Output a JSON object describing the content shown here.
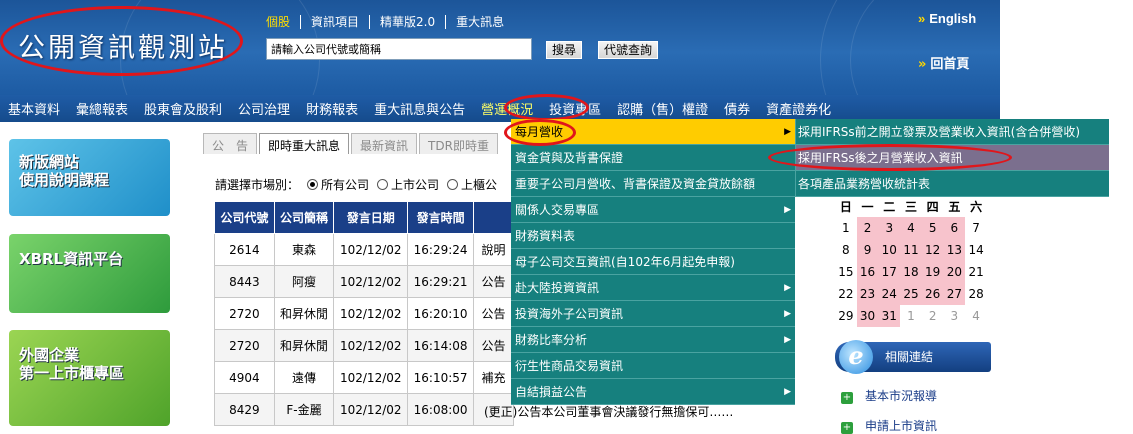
{
  "header": {
    "logo": "公開資訊觀測站",
    "top_links": [
      "個股",
      "資訊項目",
      "精華版2.0",
      "重大訊息"
    ],
    "search_placeholder": "請輸入公司代號或簡稱",
    "search_button": "搜尋",
    "code_button": "代號查詢",
    "english": "English",
    "home": "回首頁"
  },
  "nav": [
    "基本資料",
    "彙總報表",
    "股東會及股利",
    "公司治理",
    "財務報表",
    "重大訊息與公告",
    "營運概況",
    "投資專區",
    "認購（售）權證",
    "債券",
    "資產證券化"
  ],
  "banners": [
    "新版網站\n使用說明課程",
    "XBRL資訊平台",
    "外國企業\n第一上市櫃專區"
  ],
  "tabs": [
    "公　告",
    "即時重大訊息",
    "最新資訊",
    "TDR即時重"
  ],
  "market": {
    "label": "請選擇市場別：",
    "options": [
      "所有公司",
      "上市公司",
      "上櫃公"
    ]
  },
  "table": {
    "headers": [
      "公司代號",
      "公司簡稱",
      "發言日期",
      "發言時間",
      ""
    ],
    "rows": [
      [
        "2614",
        "東森",
        "102/12/02",
        "16:29:24",
        "說明"
      ],
      [
        "8443",
        "阿瘦",
        "102/12/02",
        "16:29:21",
        "公告"
      ],
      [
        "2720",
        "和昇休閒",
        "102/12/02",
        "16:20:10",
        "公告"
      ],
      [
        "2720",
        "和昇休閒",
        "102/12/02",
        "16:14:08",
        "公告"
      ],
      [
        "4904",
        "遠傳",
        "102/12/02",
        "16:10:57",
        "補充"
      ],
      [
        "8429",
        "F-金麗",
        "102/12/02",
        "16:08:00",
        ""
      ]
    ],
    "last_line": "(更正)公告本公司董事會決議發行無擔保可……"
  },
  "menu": {
    "items": [
      "每月營收",
      "資金貸與及背書保證",
      "重要子公司月營收、背書保證及資金貸放餘額",
      "關係人交易專區",
      "財務資料表",
      "母子公司交互資訊(自102年6月起免申報)",
      "赴大陸投資資訊",
      "投資海外子公司資訊",
      "財務比率分析",
      "衍生性商品交易資訊",
      "自結損益公告"
    ],
    "has_submenu": [
      true,
      false,
      false,
      true,
      false,
      false,
      true,
      true,
      true,
      false,
      true
    ],
    "submenu": [
      "採用IFRSs前之開立發票及營業收入資訊(含合併營收)",
      "採用IFRSs後之月營業收入資訊",
      "各項產品業務營收統計表"
    ]
  },
  "calendar": {
    "weekdays": [
      "日",
      "一",
      "二",
      "三",
      "四",
      "五",
      "六"
    ],
    "weeks": [
      [
        "1",
        "2",
        "3",
        "4",
        "5",
        "6",
        "7"
      ],
      [
        "8",
        "9",
        "10",
        "11",
        "12",
        "13",
        "14"
      ],
      [
        "15",
        "16",
        "17",
        "18",
        "19",
        "20",
        "21"
      ],
      [
        "22",
        "23",
        "24",
        "25",
        "26",
        "27",
        "28"
      ],
      [
        "29",
        "30",
        "31",
        "1",
        "2",
        "3",
        "4"
      ]
    ]
  },
  "related": {
    "title": "相關連結",
    "links": [
      "基本市況報導",
      "申請上市資訊"
    ]
  },
  "colors": {
    "header_blue": "#1c5599",
    "menu_teal": "#16807e",
    "highlight": "#ffcc00",
    "annotation_red": "#e0161b"
  }
}
